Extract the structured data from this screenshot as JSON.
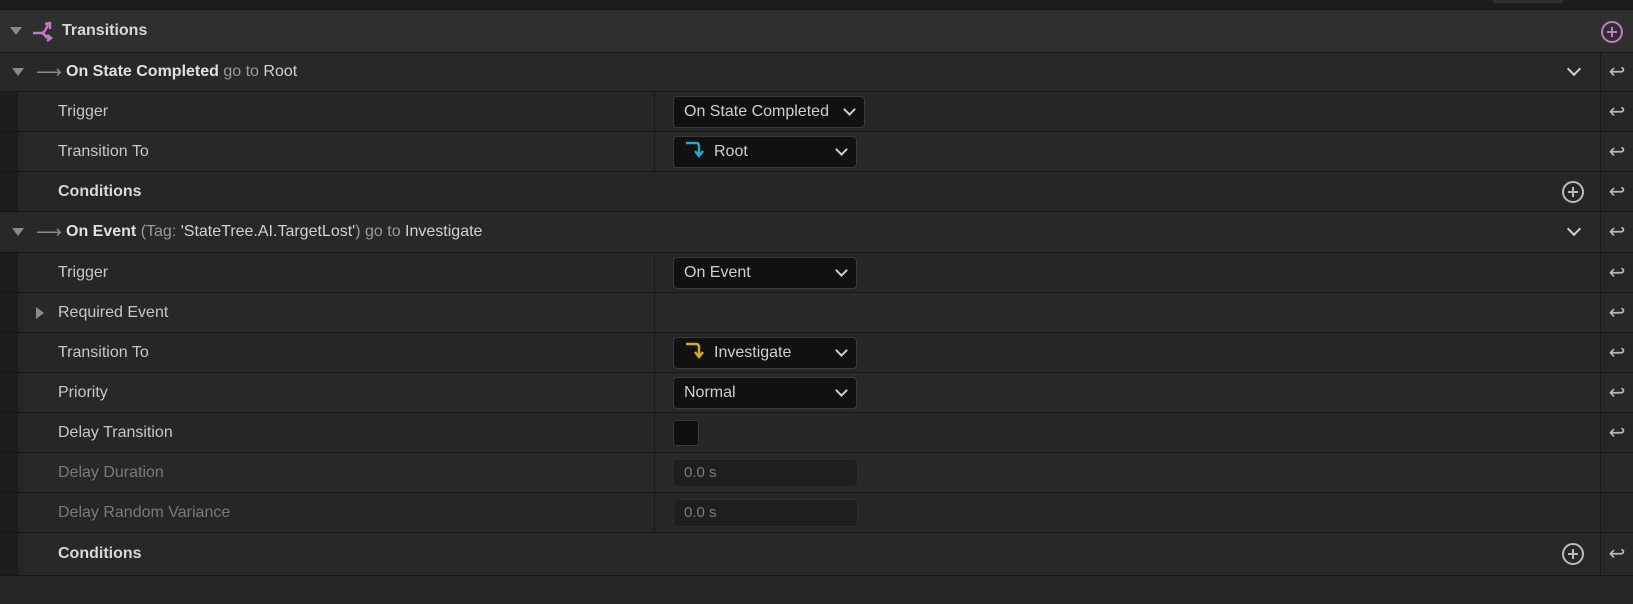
{
  "section": {
    "title": "Transitions",
    "icon": "transitions-icon",
    "accent_color": "#c27bc6"
  },
  "transitions": [
    {
      "header": {
        "name": "On State Completed",
        "goto_word": "go to",
        "target": "Root"
      },
      "trigger_label": "Trigger",
      "trigger_value": "On State Completed",
      "transition_to_label": "Transition To",
      "transition_to_value": "Root",
      "transition_icon_color": "#2aa7c9",
      "conditions_label": "Conditions"
    },
    {
      "header": {
        "name": "On Event",
        "paren_open": "(",
        "tag_word": "Tag:",
        "tag_value": "'StateTree.AI.TargetLost'",
        "paren_close": ")",
        "goto_word": "go to",
        "target": "Investigate"
      },
      "trigger_label": "Trigger",
      "trigger_value": "On Event",
      "required_event_label": "Required Event",
      "transition_to_label": "Transition To",
      "transition_to_value": "Investigate",
      "transition_icon_color": "#d4a92a",
      "priority_label": "Priority",
      "priority_value": "Normal",
      "delay_transition_label": "Delay Transition",
      "delay_transition_checked": false,
      "delay_duration_label": "Delay Duration",
      "delay_duration_value": "0.0 s",
      "delay_random_label": "Delay Random Variance",
      "delay_random_value": "0.0 s",
      "conditions_label": "Conditions"
    }
  ]
}
